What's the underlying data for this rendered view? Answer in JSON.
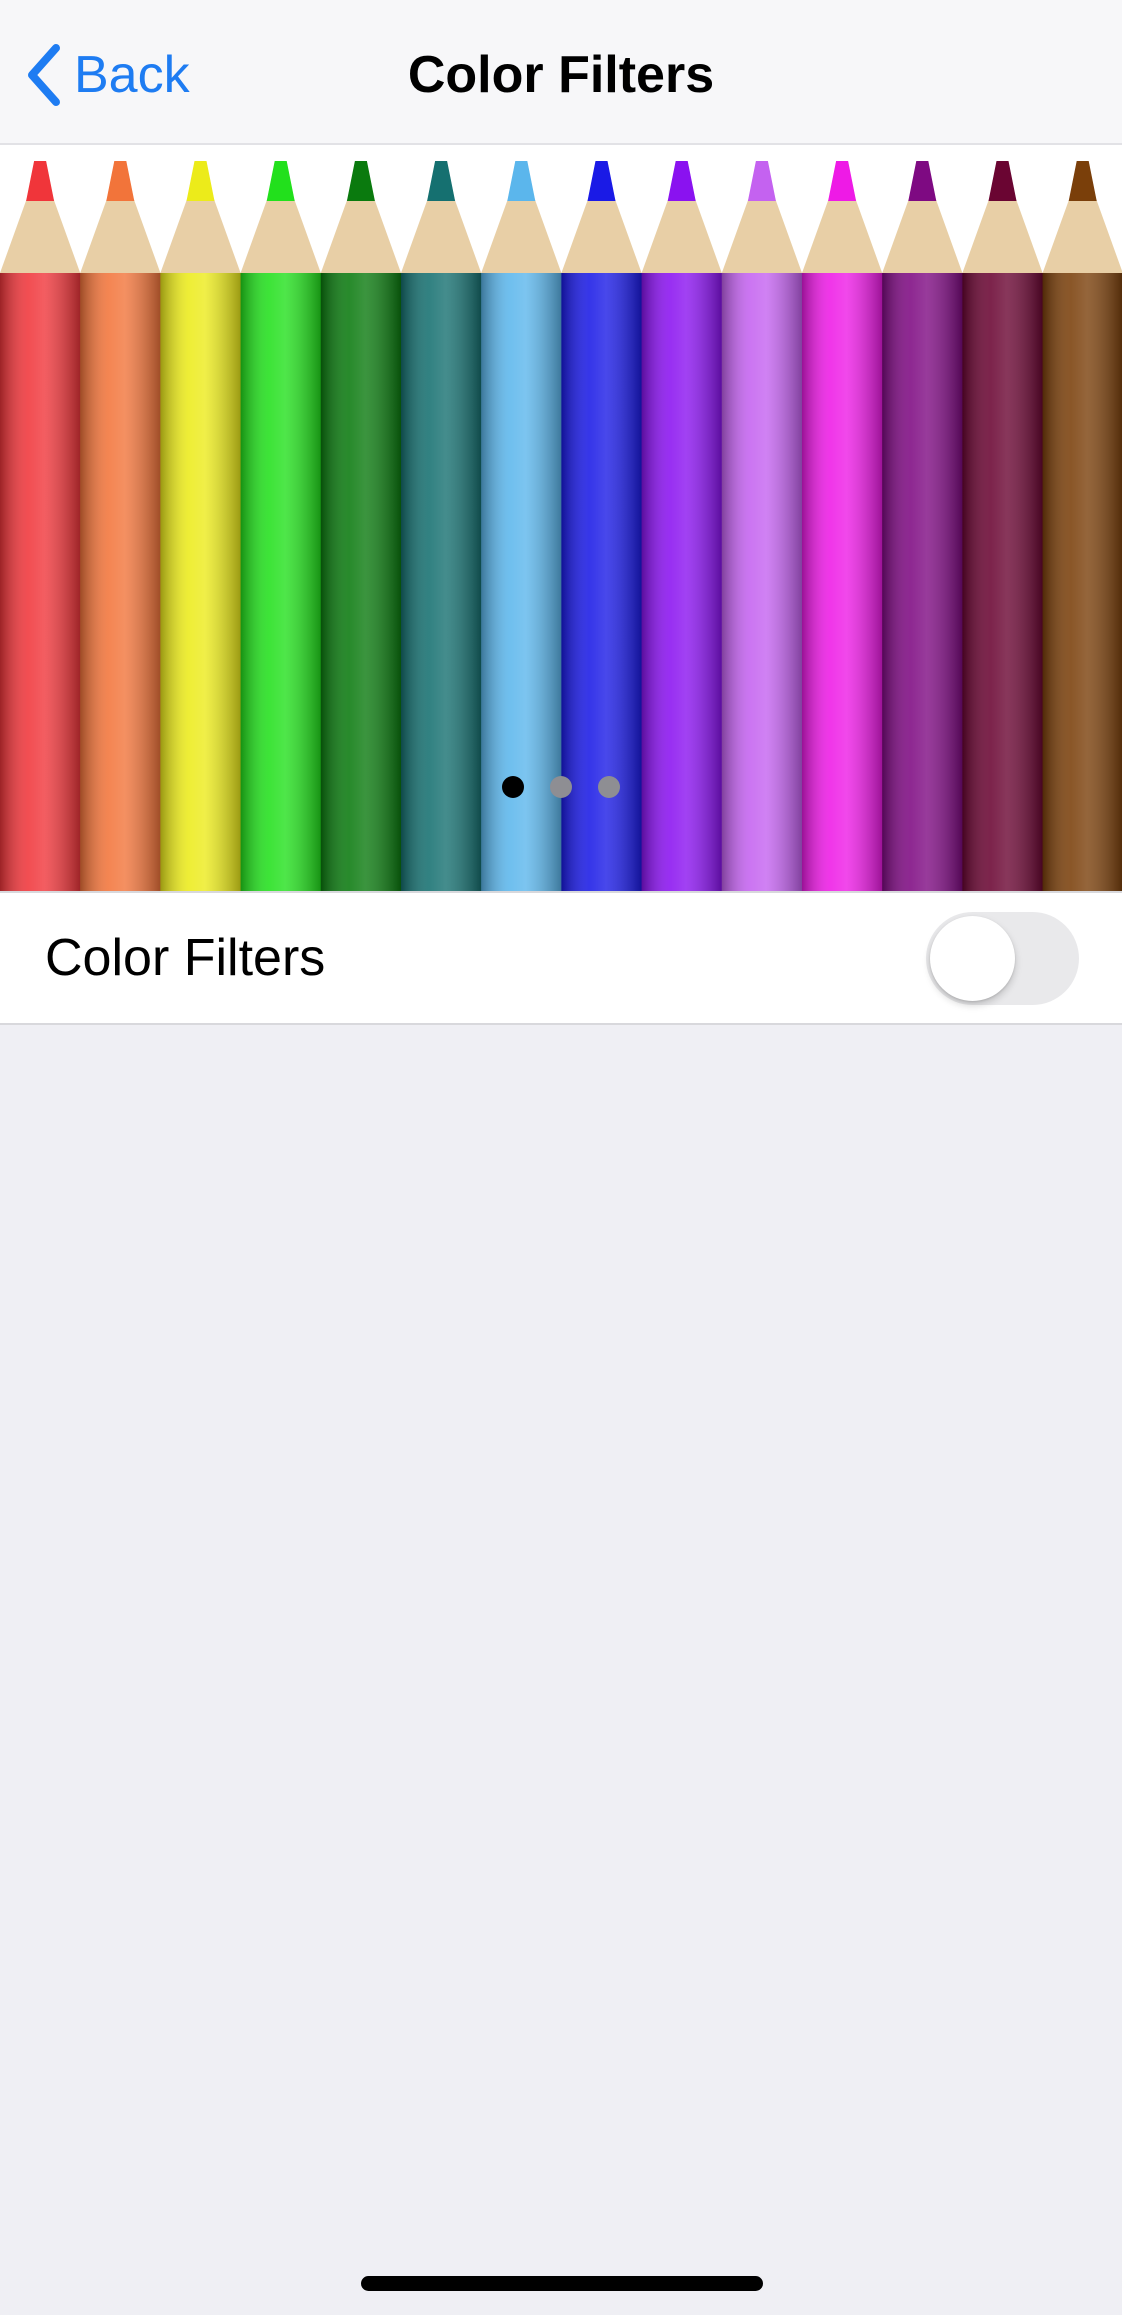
{
  "nav": {
    "back_label": "Back",
    "title": "Color Filters"
  },
  "preview": {
    "pencil_colors": [
      "#f0353a",
      "#f2743a",
      "#eceb1a",
      "#22e01c",
      "#0a7a0e",
      "#157070",
      "#5bb6ec",
      "#1a1ae6",
      "#8a12f0",
      "#c462f0",
      "#ee1ae6",
      "#7e0a82",
      "#6a0532",
      "#7a3f0a"
    ],
    "page_count": 3,
    "active_page": 0
  },
  "settings": {
    "color_filters_label": "Color Filters",
    "color_filters_enabled": false
  }
}
